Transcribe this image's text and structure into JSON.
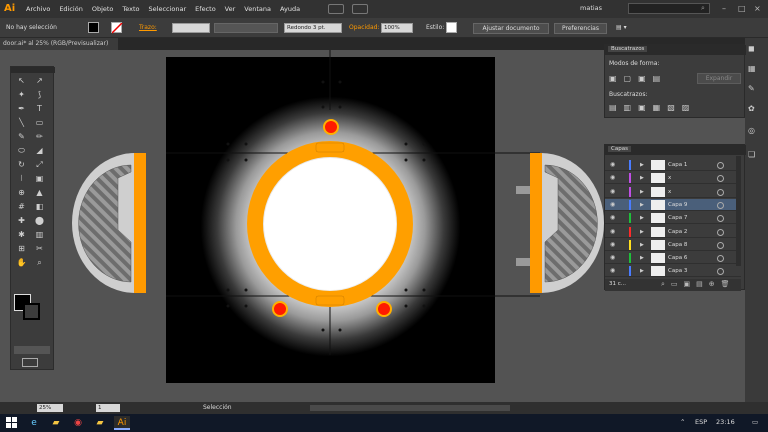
{
  "app": {
    "logo": "Ai",
    "brand_color": "#ff9a00"
  },
  "menu": [
    "Archivo",
    "Edición",
    "Objeto",
    "Texto",
    "Seleccionar",
    "Efecto",
    "Ver",
    "Ventana",
    "Ayuda"
  ],
  "user": "matias",
  "control": {
    "selection": "No hay selección",
    "stroke_label": "Trazo:",
    "brush": "Redondo 3 pt.",
    "opacity_label": "Opacidad:",
    "opacity_value": "100%",
    "style_label": "Estilo:",
    "doc_button": "Ajustar documento",
    "prefs_button": "Preferencias"
  },
  "document_tab": "door.ai* al 25% (RGB/Previsualizar)",
  "pathfinder": {
    "title": "Buscatrazos",
    "shape_modes_label": "Modos de forma:",
    "expand_button": "Expandir",
    "pathfinders_label": "Buscatrazos:"
  },
  "layers": {
    "title": "Capas",
    "rows": [
      {
        "name": "Capa 1",
        "color": "#4a7cff"
      },
      {
        "name": "x",
        "color": "#c04fe6"
      },
      {
        "name": "x",
        "color": "#c04fe6"
      },
      {
        "name": "Capa 9",
        "color": "#4a7cff",
        "selected": true
      },
      {
        "name": "Capa 7",
        "color": "#1fbf3a"
      },
      {
        "name": "Capa 2",
        "color": "#ff2a2a"
      },
      {
        "name": "Capa 8",
        "color": "#ffdf1f"
      },
      {
        "name": "Capa 6",
        "color": "#1fbf3a"
      },
      {
        "name": "Capa 3",
        "color": "#4a7cff"
      }
    ],
    "count": "31 c..."
  },
  "status": {
    "zoom": "25%",
    "page": "1",
    "tool": "Selección"
  },
  "taskbar": {
    "lang": "ESP",
    "time": "23:16"
  },
  "icons": [
    "selection-icon",
    "direct-selection-icon",
    "magic-wand-icon",
    "lasso-icon",
    "pen-icon",
    "type-icon",
    "line-icon",
    "rectangle-icon",
    "paintbrush-icon",
    "pencil-icon",
    "blob-brush-icon",
    "eraser-icon",
    "rotate-icon",
    "scale-icon",
    "width-icon",
    "free-transform-icon",
    "shape-builder-icon",
    "perspective-icon",
    "mesh-icon",
    "gradient-icon",
    "eyedropper-icon",
    "blend-icon",
    "symbol-sprayer-icon",
    "graph-icon",
    "artboard-icon",
    "slice-icon",
    "hand-icon",
    "zoom-icon"
  ]
}
